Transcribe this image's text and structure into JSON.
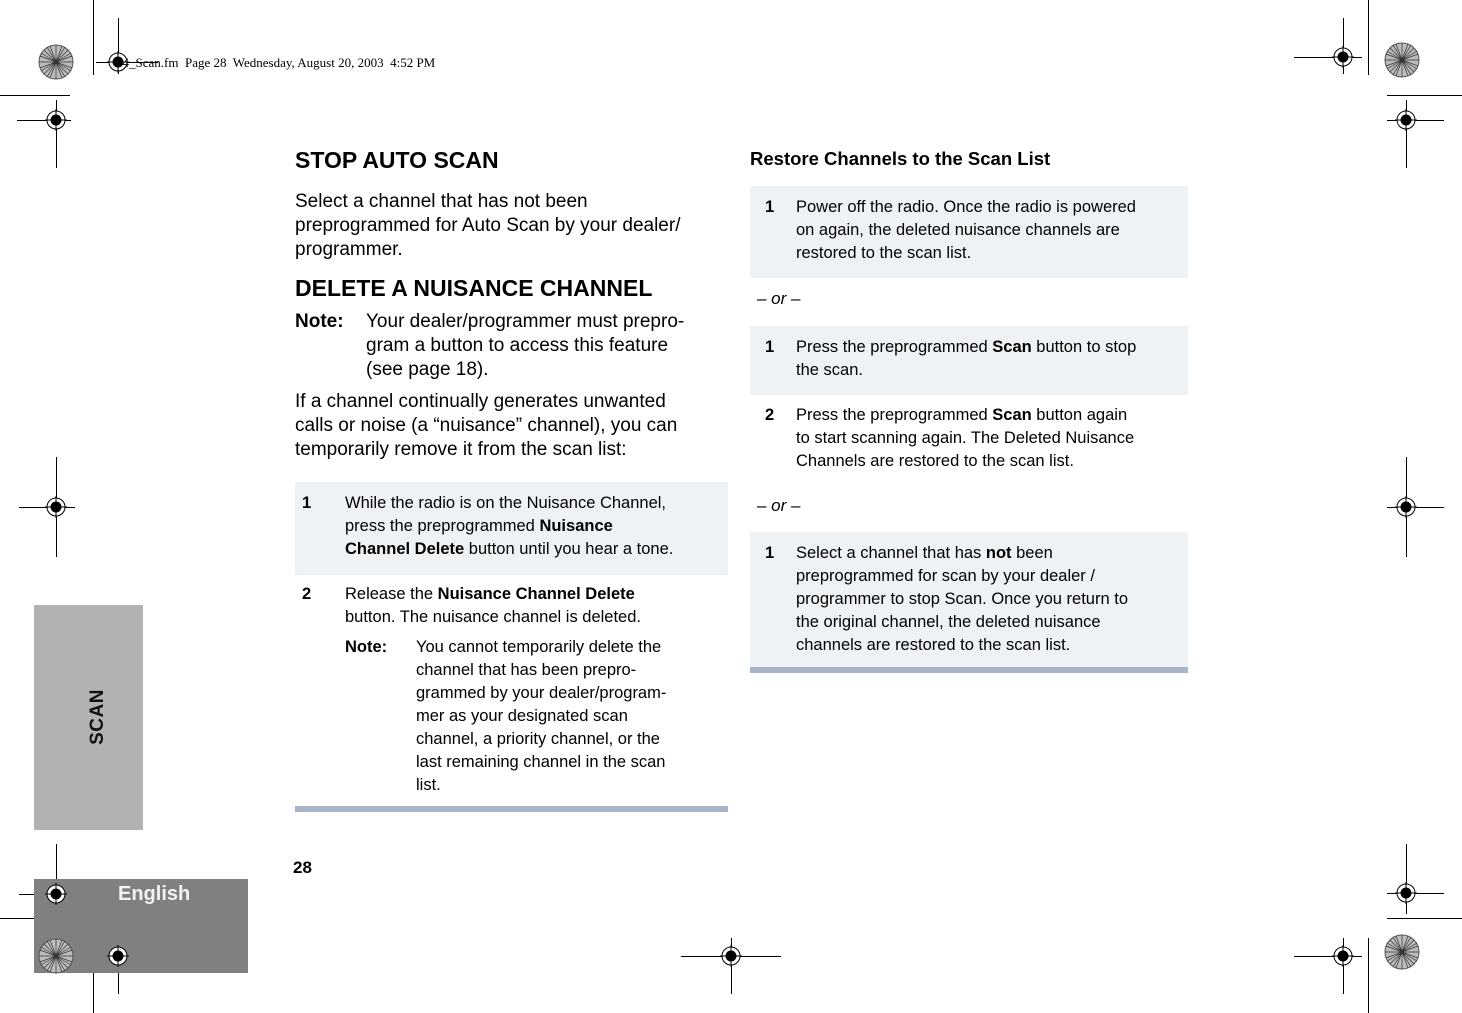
{
  "header": {
    "print_line": "04_Scan.fm  Page 28  Wednesday, August 20, 2003  4:52 PM"
  },
  "side_tabs": {
    "section": "SCAN",
    "language": "English"
  },
  "page_number": "28",
  "left_column": {
    "stop_auto_scan": {
      "title": "STOP AUTO SCAN",
      "body": "Select a channel that has not been preprogrammed for Auto Scan by your dealer/ programmer."
    },
    "delete_nuisance": {
      "title": "DELETE A NUISANCE CHANNEL",
      "note_label": "Note:",
      "note_lines": [
        "Your dealer/programmer must prepro-",
        "gram a button to access this feature",
        "(see page 18)."
      ],
      "intro_lines": [
        "If a channel continually generates unwanted",
        "calls or noise (a “nuisance” channel), you can",
        "temporarily remove it from the scan list:"
      ],
      "steps": [
        {
          "num": "1",
          "lines": [
            [
              {
                "t": "While the radio is on the Nuisance Channel,"
              }
            ],
            [
              {
                "t": "press the preprogrammed "
              },
              {
                "t": "Nuisance",
                "b": true
              }
            ],
            [
              {
                "t": "Channel Delete",
                "b": true
              },
              {
                "t": " button until you hear a tone."
              }
            ]
          ]
        },
        {
          "num": "2",
          "lines": [
            [
              {
                "t": "Release the "
              },
              {
                "t": "Nuisance Channel Delete",
                "b": true
              }
            ],
            [
              {
                "t": "button. The nuisance channel is deleted."
              }
            ]
          ],
          "note_label": "Note:",
          "note_lines": [
            "You cannot temporarily delete the",
            "channel that has been prepro-",
            "grammed by your dealer/program-",
            "mer as your designated scan",
            "channel, a priority channel, or the",
            "last remaining channel in the scan",
            "list."
          ]
        }
      ]
    }
  },
  "right_column": {
    "title": "Restore Channels to the Scan List",
    "or_label": "– or –",
    "option1": [
      {
        "num": "1",
        "lines": [
          [
            {
              "t": "Power off the radio. Once the radio is powered"
            }
          ],
          [
            {
              "t": "on again, the deleted nuisance channels are"
            }
          ],
          [
            {
              "t": "restored to the scan list."
            }
          ]
        ]
      }
    ],
    "option2": [
      {
        "num": "1",
        "lines": [
          [
            {
              "t": "Press the preprogrammed "
            },
            {
              "t": "Scan",
              "b": true
            },
            {
              "t": " button to stop"
            }
          ],
          [
            {
              "t": "the scan."
            }
          ]
        ]
      },
      {
        "num": "2",
        "lines": [
          [
            {
              "t": "Press the preprogrammed "
            },
            {
              "t": "Scan",
              "b": true
            },
            {
              "t": " button again"
            }
          ],
          [
            {
              "t": "to start scanning again. The Deleted Nuisance"
            }
          ],
          [
            {
              "t": "Channels are restored to the scan list."
            }
          ]
        ]
      }
    ],
    "option3": [
      {
        "num": "1",
        "lines": [
          [
            {
              "t": "Select a channel that has "
            },
            {
              "t": "not",
              "b": true
            },
            {
              "t": " been"
            }
          ],
          [
            {
              "t": "preprogrammed for scan by your dealer /"
            }
          ],
          [
            {
              "t": "programmer to stop Scan. Once you return to"
            }
          ],
          [
            {
              "t": "the original channel, the deleted nuisance"
            }
          ],
          [
            {
              "t": "channels are restored to the scan list."
            }
          ]
        ]
      }
    ]
  },
  "colors": {
    "step_box_bg": "#eff2f5",
    "rule": "#a6b6c8",
    "scan_tab": "#b2b2b2",
    "english_tab": "#808080"
  }
}
